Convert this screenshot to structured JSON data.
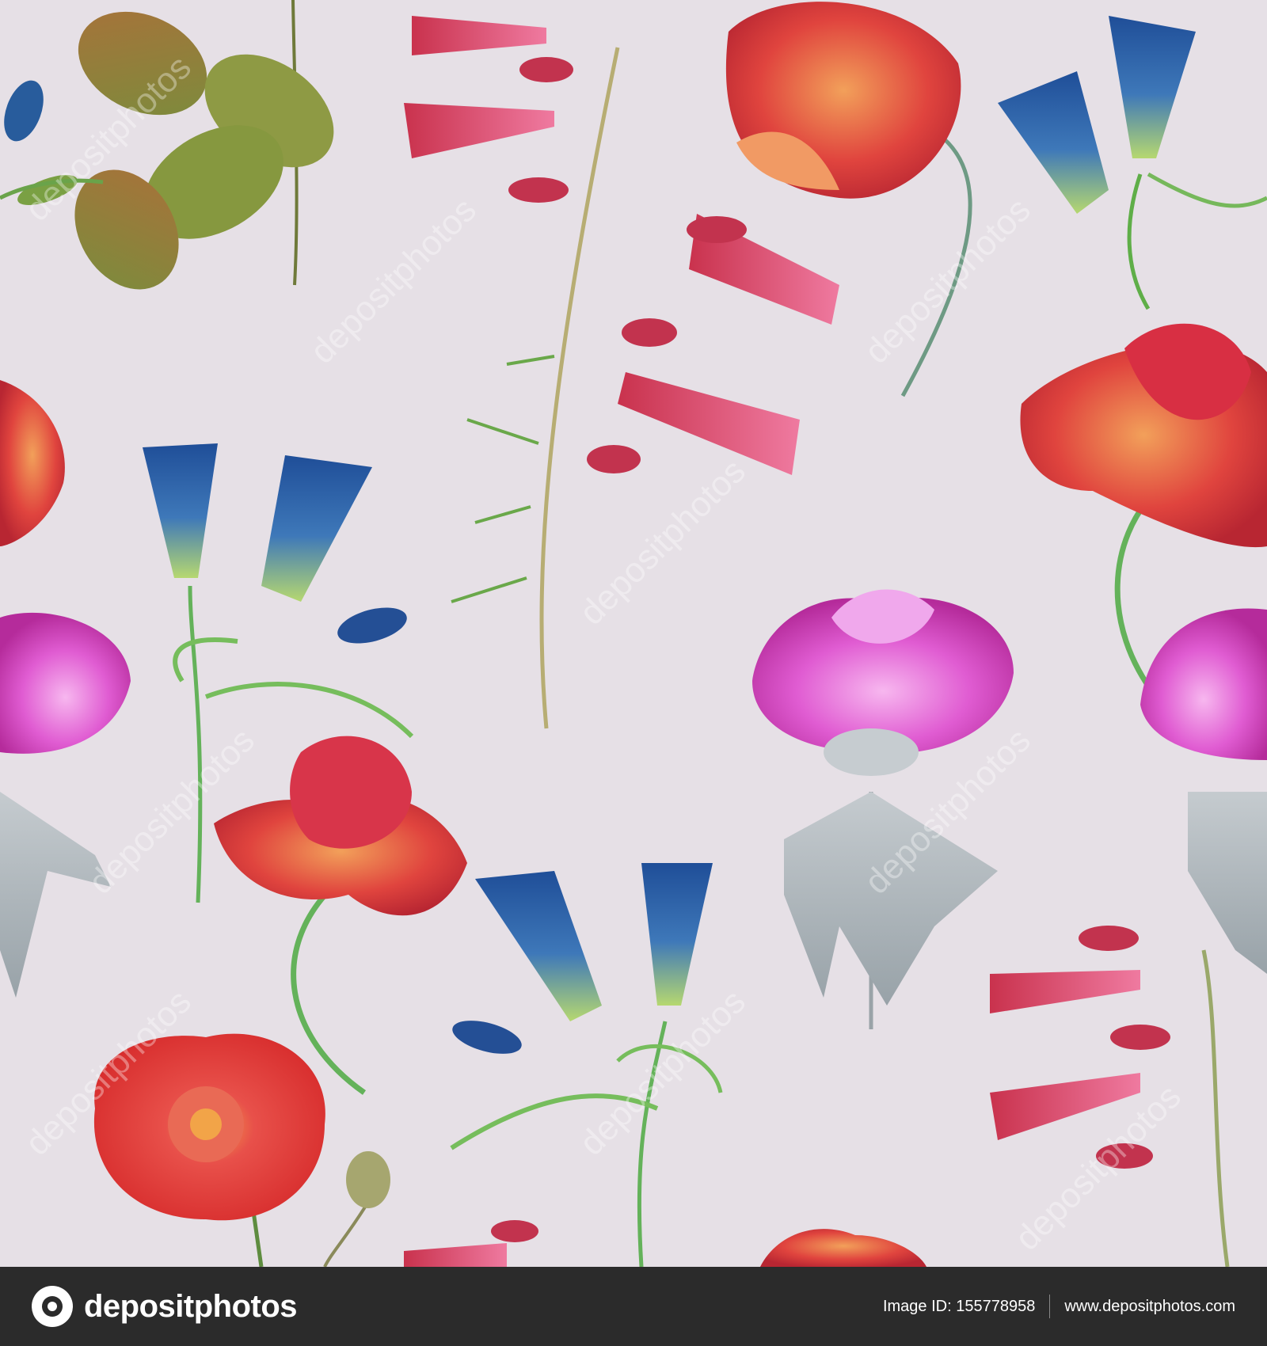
{
  "image": {
    "background_color": "#e6e0e6",
    "motifs": [
      "rose-leaves",
      "penstemon-stem",
      "parrot-tulip",
      "gentian",
      "peony",
      "rose-bloom",
      "rose-bud"
    ]
  },
  "watermark": {
    "text": "depositphotos"
  },
  "footer": {
    "brand": "depositphotos",
    "image_id": "Image ID: 155778958",
    "site": "www.depositphotos.com",
    "background_color": "#2b2b2b"
  }
}
